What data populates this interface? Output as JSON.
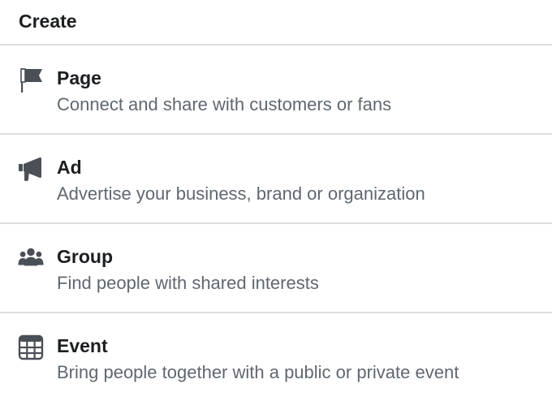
{
  "menu": {
    "header": "Create",
    "items": [
      {
        "title": "Page",
        "description": "Connect and share with customers or fans",
        "icon": "flag-icon"
      },
      {
        "title": "Ad",
        "description": "Advertise your business, brand or organization",
        "icon": "megaphone-icon"
      },
      {
        "title": "Group",
        "description": "Find people with shared interests",
        "icon": "group-icon"
      },
      {
        "title": "Event",
        "description": "Bring people together with a public or private event",
        "icon": "calendar-icon"
      }
    ]
  },
  "colors": {
    "title": "#1c1e21",
    "description": "#606770",
    "icon": "#4b4f56",
    "divider": "#dadde1"
  }
}
